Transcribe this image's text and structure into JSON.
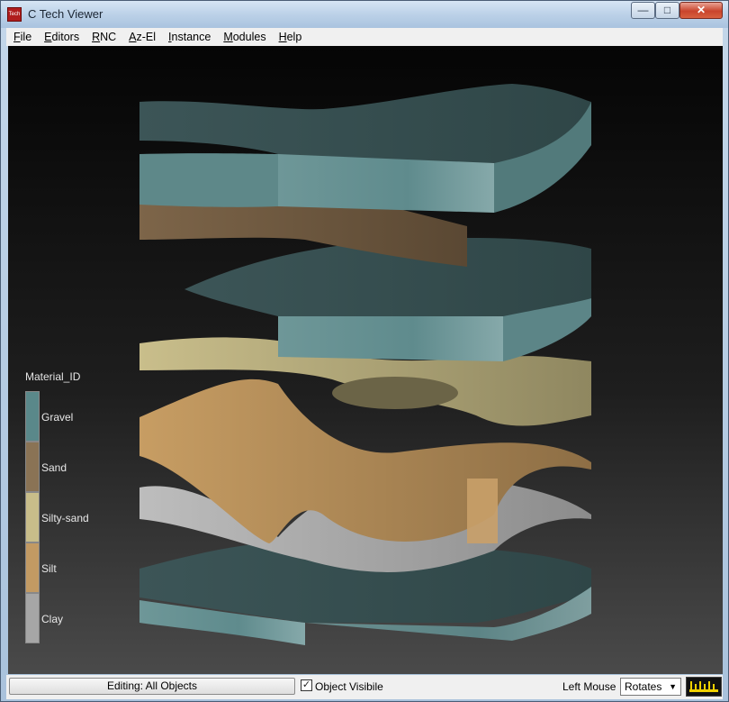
{
  "window": {
    "title": "C Tech Viewer",
    "icon_text": "Tech"
  },
  "controls": {
    "minimize": "—",
    "maximize": "□",
    "close": "✕"
  },
  "menu": [
    "File",
    "Editors",
    "RNC",
    "Az-El",
    "Instance",
    "Modules",
    "Help"
  ],
  "legend": {
    "title": "Material_ID",
    "items": [
      {
        "label": "Gravel",
        "color": "#5a888a"
      },
      {
        "label": "Sand",
        "color": "#8a7355"
      },
      {
        "label": "Silty-sand",
        "color": "#c8bd8a"
      },
      {
        "label": "Silt",
        "color": "#c29a63"
      },
      {
        "label": "Clay",
        "color": "#a6a6a6"
      }
    ]
  },
  "status": {
    "editing_label": "Editing: All Objects",
    "object_visible_label": "Object Visibile",
    "object_visible_checked": true,
    "mouse_label": "Left Mouse",
    "mouse_mode": "Rotates"
  },
  "icons": {
    "app": "app-icon",
    "ruler": "ruler-icon",
    "dropdown": "chevron-down-icon"
  }
}
